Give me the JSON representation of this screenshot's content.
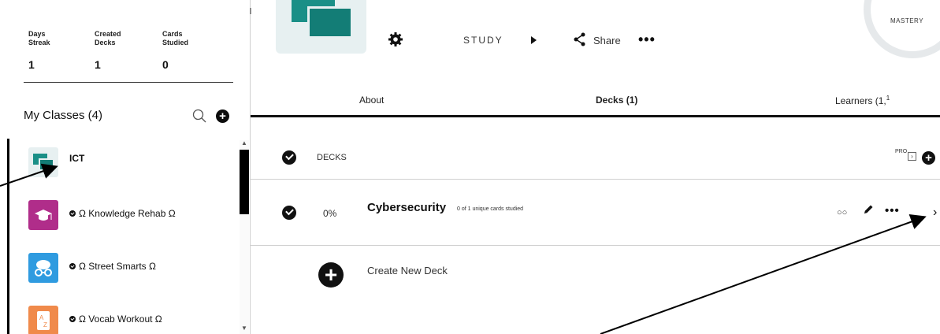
{
  "stats": [
    {
      "label_line1": "Days",
      "label_line2": "Streak",
      "value": "1"
    },
    {
      "label_line1": "Created",
      "label_line2": "Decks",
      "value": "1"
    },
    {
      "label_line1": "Cards",
      "label_line2": "Studied",
      "value": "0"
    }
  ],
  "classes": {
    "title": "My Classes (4)",
    "items": [
      {
        "label": "ICT",
        "color": "#1a8f87",
        "icon": "deck-squares-icon",
        "verified": false
      },
      {
        "label": "Ω Knowledge Rehab Ω",
        "color": "#b02d8a",
        "icon": "graduation-cap-icon",
        "verified": true
      },
      {
        "label": "Ω Street Smarts Ω",
        "color": "#2f9be0",
        "icon": "brain-glasses-icon",
        "verified": true
      },
      {
        "label": "Ω Vocab Workout Ω",
        "color": "#f08a4b",
        "icon": "dictionary-icon",
        "verified": true
      }
    ]
  },
  "toolbar": {
    "study_label": "STUDY",
    "share_label": "Share",
    "more_label": "•••"
  },
  "mastery": {
    "label": "MASTERY"
  },
  "tabs": [
    {
      "label": "About",
      "active": false
    },
    {
      "label": "Decks (1)",
      "active": true
    },
    {
      "label": "Learners (1,",
      "active": false
    }
  ],
  "decks_header": {
    "label": "DECKS",
    "pro_label": "PRO"
  },
  "deck": {
    "percent": "0%",
    "name": "Cybersecurity",
    "subtitle": "0 of 1 unique cards studied",
    "more_label": "•••"
  },
  "create": {
    "label": "Create New Deck"
  },
  "colors": {
    "accent": "#1a8f87",
    "dark": "#111111"
  }
}
